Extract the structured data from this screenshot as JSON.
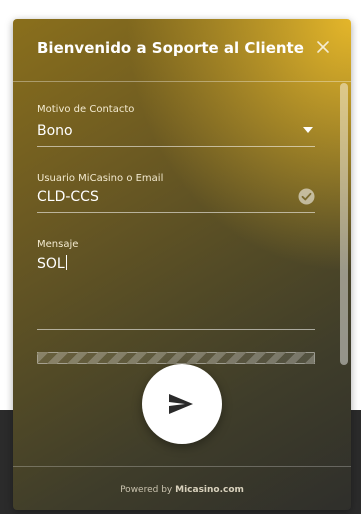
{
  "header": {
    "title": "Bienvenido a Soporte al Cliente",
    "close_icon": "close-icon"
  },
  "form": {
    "contact_reason": {
      "label": "Motivo de Contacto",
      "value": "Bono",
      "icon": "chevron-down-icon"
    },
    "user_email": {
      "label": "Usuario MiCasino o Email",
      "value": "CLD-CCS",
      "icon": "check-circle-icon"
    },
    "message": {
      "label": "Mensaje",
      "value": "SOL"
    }
  },
  "send_button": {
    "icon": "send-icon"
  },
  "footer": {
    "prefix": "Powered by",
    "brand": "Micasino.com"
  },
  "colors": {
    "accent_gold": "#e4b62a",
    "dark": "#2f2f2b",
    "text": "#ffffff"
  }
}
